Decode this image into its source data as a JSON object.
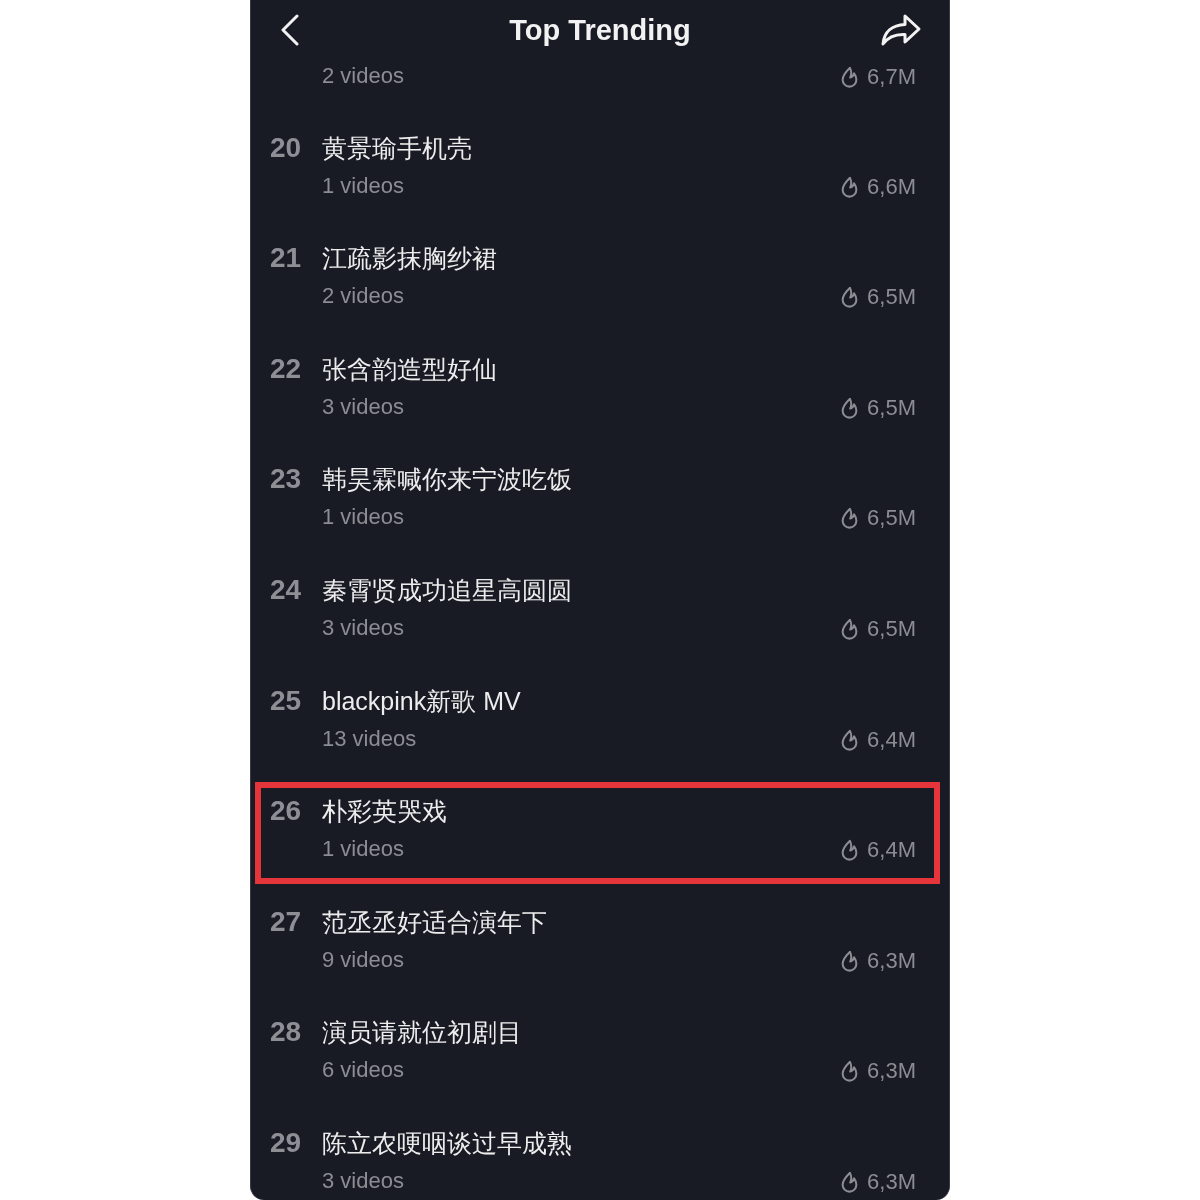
{
  "header": {
    "title": "Top Trending"
  },
  "items": [
    {
      "videos": "2 videos",
      "views": "6,7M",
      "highlighted": false
    },
    {
      "rank": "20",
      "title": "黄景瑜手机壳",
      "videos": "1 videos",
      "views": "6,6M",
      "highlighted": false
    },
    {
      "rank": "21",
      "title": "江疏影抹胸纱裙",
      "videos": "2 videos",
      "views": "6,5M",
      "highlighted": false
    },
    {
      "rank": "22",
      "title": "张含韵造型好仙",
      "videos": "3 videos",
      "views": "6,5M",
      "highlighted": false
    },
    {
      "rank": "23",
      "title": "韩昊霖喊你来宁波吃饭",
      "videos": "1 videos",
      "views": "6,5M",
      "highlighted": false
    },
    {
      "rank": "24",
      "title": "秦霄贤成功追星高圆圆",
      "videos": "3 videos",
      "views": "6,5M",
      "highlighted": false
    },
    {
      "rank": "25",
      "title": "blackpink新歌 MV",
      "videos": "13 videos",
      "views": "6,4M",
      "highlighted": false
    },
    {
      "rank": "26",
      "title": "朴彩英哭戏",
      "videos": "1 videos",
      "views": "6,4M",
      "highlighted": true
    },
    {
      "rank": "27",
      "title": "范丞丞好适合演年下",
      "videos": "9 videos",
      "views": "6,3M",
      "highlighted": false
    },
    {
      "rank": "28",
      "title": "演员请就位初剧目",
      "videos": "6 videos",
      "views": "6,3M",
      "highlighted": false
    },
    {
      "rank": "29",
      "title": "陈立农哽咽谈过早成熟",
      "videos": "3 videos",
      "views": "6,3M",
      "highlighted": false
    }
  ]
}
